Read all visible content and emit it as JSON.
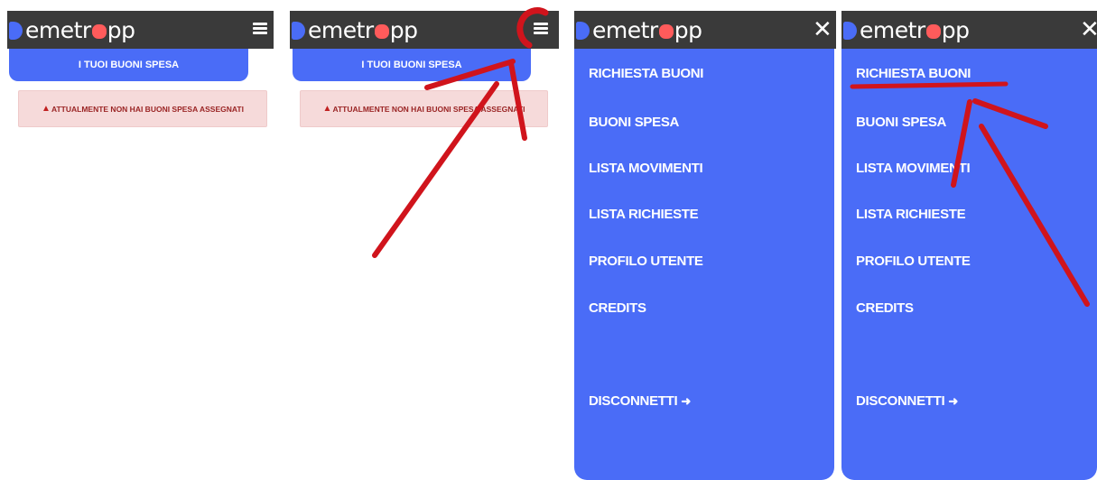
{
  "app": {
    "logo_d": "D",
    "logo_text1": "emetr",
    "logo_text2": "pp"
  },
  "main": {
    "title_button": "I TUOI BUONI SPESA",
    "alert_text": "ATTUALMENTE NON HAI BUONI SPESA ASSEGNATI"
  },
  "menu": {
    "items": [
      "RICHIESTA BUONI",
      "BUONI SPESA",
      "LISTA MOVIMENTI",
      "LISTA RICHIESTE",
      "PROFILO UTENTE",
      "CREDITS"
    ],
    "logout": "DISCONNETTI"
  },
  "icons": [
    "hamburger-icon",
    "close-icon",
    "warning-icon",
    "sign-out-icon"
  ],
  "colors": {
    "appbar": "#3a3a3a",
    "accent": "#4a6cf7",
    "logo_a": "#ff5b5b",
    "alert_bg": "#f6dada",
    "annotation": "#d0141c"
  }
}
